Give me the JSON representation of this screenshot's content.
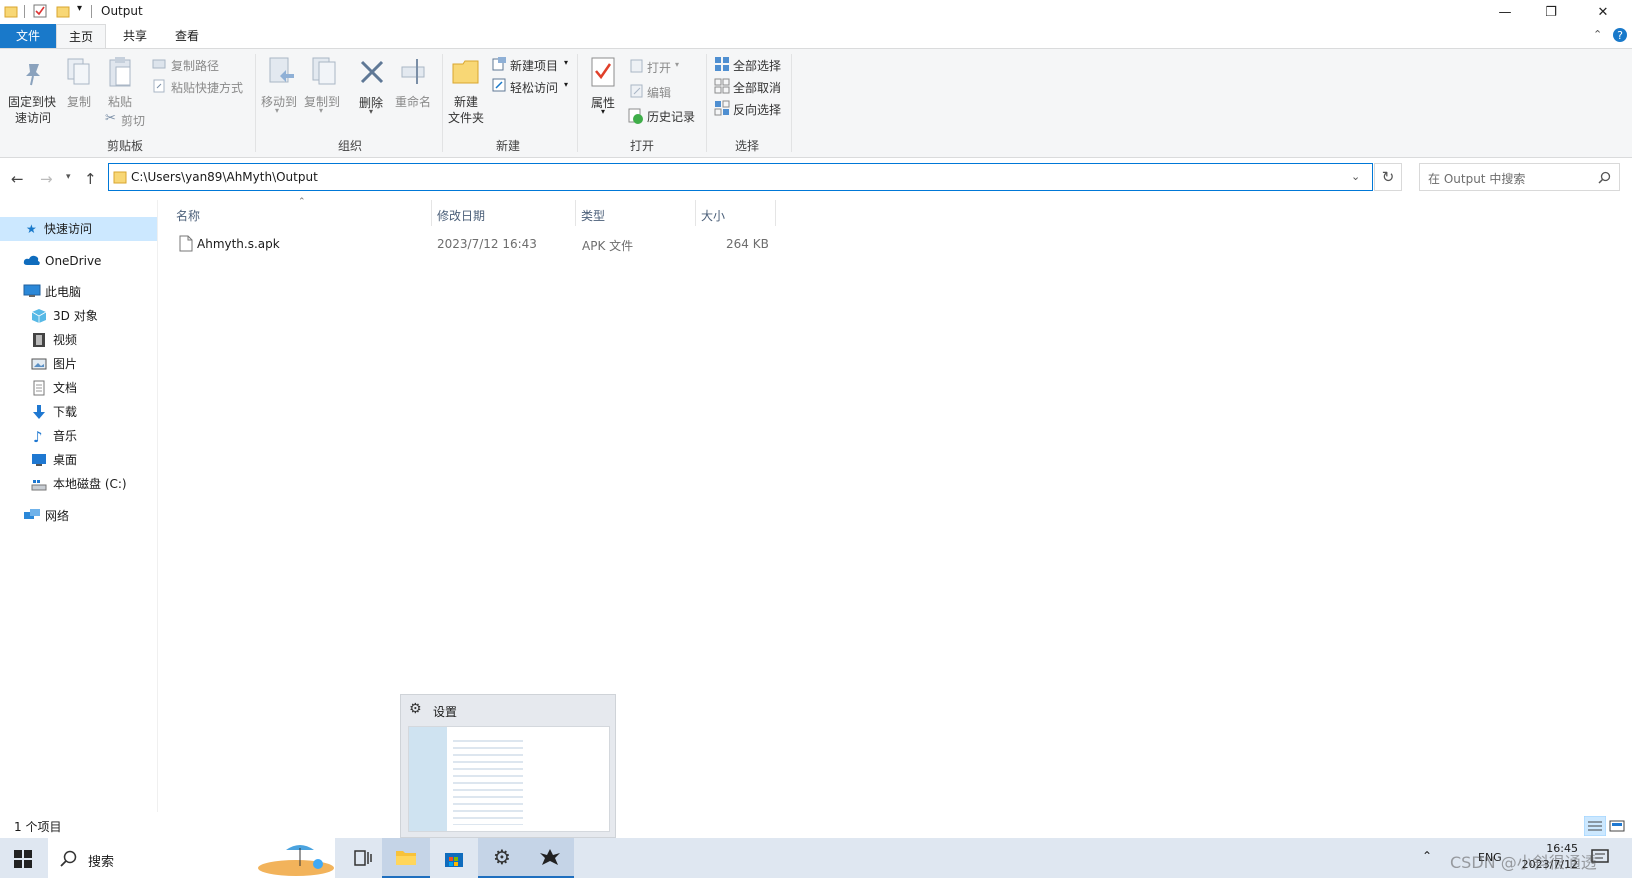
{
  "window": {
    "title": "Output"
  },
  "ribbon": {
    "tabs": [
      "文件",
      "主页",
      "共享",
      "查看"
    ],
    "clipboard": {
      "pin_line1": "固定到快",
      "pin_line2": "速访问",
      "copy": "复制",
      "paste": "粘贴",
      "copy_path": "复制路径",
      "paste_shortcut": "粘贴快捷方式",
      "cut": "剪切",
      "label": "剪贴板"
    },
    "organize": {
      "move_to": "移动到",
      "copy_to": "复制到",
      "delete": "删除",
      "rename": "重命名",
      "label": "组织"
    },
    "new": {
      "new_folder_line1": "新建",
      "new_folder_line2": "文件夹",
      "new_item": "新建项目",
      "easy_access": "轻松访问",
      "label": "新建"
    },
    "open": {
      "properties": "属性",
      "open": "打开",
      "edit": "编辑",
      "history": "历史记录",
      "label": "打开"
    },
    "select": {
      "select_all": "全部选择",
      "select_none": "全部取消",
      "invert": "反向选择",
      "label": "选择"
    }
  },
  "address": {
    "path": "C:\\Users\\yan89\\AhMyth\\Output"
  },
  "search": {
    "placeholder": "在 Output 中搜索"
  },
  "nav": {
    "quick_access": "快速访问",
    "onedrive": "OneDrive",
    "this_pc": "此电脑",
    "objects3d": "3D 对象",
    "videos": "视频",
    "pictures": "图片",
    "documents": "文档",
    "downloads": "下载",
    "music": "音乐",
    "desktop": "桌面",
    "local_disk": "本地磁盘 (C:)",
    "network": "网络"
  },
  "columns": {
    "name": "名称",
    "modified": "修改日期",
    "type": "类型",
    "size": "大小"
  },
  "files": [
    {
      "name": "Ahmyth.s.apk",
      "modified": "2023/7/12 16:43",
      "type": "APK 文件",
      "size": "264 KB"
    }
  ],
  "status": {
    "count": "1 个项目"
  },
  "popup": {
    "title": "设置"
  },
  "taskbar": {
    "search": "搜索",
    "tray_text": "ENG",
    "time": "16:45",
    "date": "2023/7/12",
    "watermark": "CSDN @小斜很通透"
  },
  "colors": {
    "accent": "#1979ca",
    "selection": "#cce8ff",
    "address_border": "#0078d7"
  }
}
